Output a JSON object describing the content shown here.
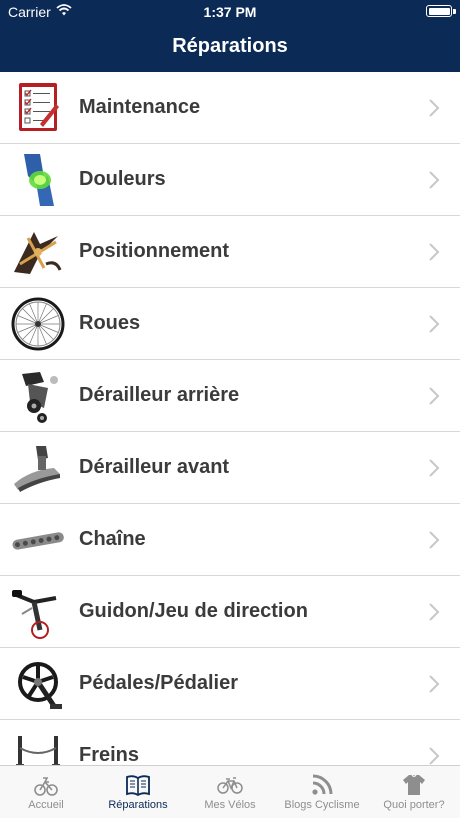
{
  "status_bar": {
    "carrier": "Carrier",
    "time": "1:37 PM"
  },
  "header": {
    "title": "Réparations"
  },
  "items": [
    {
      "label": "Maintenance",
      "icon": "checklist-icon"
    },
    {
      "label": "Douleurs",
      "icon": "knee-icon"
    },
    {
      "label": "Positionnement",
      "icon": "rider-position-icon"
    },
    {
      "label": "Roues",
      "icon": "wheel-icon"
    },
    {
      "label": "Dérailleur arrière",
      "icon": "rear-derailleur-icon"
    },
    {
      "label": "Dérailleur avant",
      "icon": "front-derailleur-icon"
    },
    {
      "label": "Chaîne",
      "icon": "chain-icon"
    },
    {
      "label": "Guidon/Jeu de direction",
      "icon": "handlebar-icon"
    },
    {
      "label": "Pédales/Pédalier",
      "icon": "crankset-icon"
    },
    {
      "label": "Freins",
      "icon": "brake-icon"
    }
  ],
  "tabs": [
    {
      "label": "Accueil",
      "icon": "home-bike-icon",
      "active": false
    },
    {
      "label": "Réparations",
      "icon": "book-icon",
      "active": true
    },
    {
      "label": "Mes Vélos",
      "icon": "bicycle-icon",
      "active": false
    },
    {
      "label": "Blogs Cyclisme",
      "icon": "rss-icon",
      "active": false
    },
    {
      "label": "Quoi porter?",
      "icon": "jersey-icon",
      "active": false
    }
  ],
  "colors": {
    "header_bg": "#0b2a55",
    "active_tab": "#0b2a55",
    "inactive_tab": "#8e8e8e",
    "label": "#3b3b3b"
  }
}
